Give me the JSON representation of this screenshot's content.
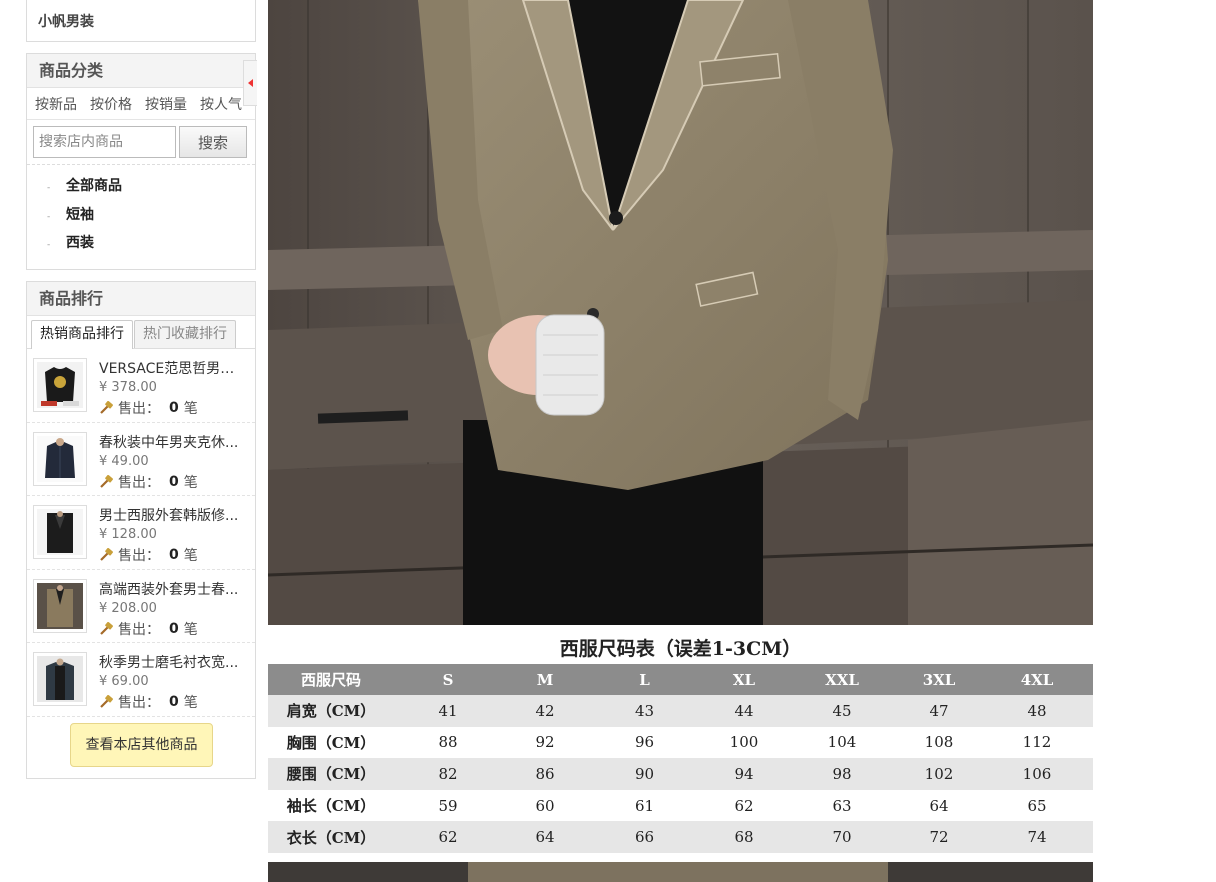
{
  "shop": {
    "name": "小帆男装"
  },
  "category": {
    "title": "商品分类",
    "sort_options": [
      "按新品",
      "按价格",
      "按销量",
      "按人气"
    ],
    "search": {
      "placeholder": "搜索店内商品",
      "button": "搜索"
    },
    "items": [
      "全部商品",
      "短袖",
      "西装"
    ],
    "bullet": "-"
  },
  "ranking": {
    "title": "商品排行",
    "tabs": [
      "热销商品排行",
      "热门收藏排行"
    ],
    "sold_label": "售出：",
    "sold_unit": "笔",
    "products": [
      {
        "name": "VERSACE范思哲男装...",
        "price": "¥ 378.00",
        "sold": "0"
      },
      {
        "name": "春秋装中年男夹克休...",
        "price": "¥ 49.00",
        "sold": "0"
      },
      {
        "name": "男士西服外套韩版修...",
        "price": "¥ 128.00",
        "sold": "0"
      },
      {
        "name": "高端西装外套男士春...",
        "price": "¥ 208.00",
        "sold": "0"
      },
      {
        "name": "秋季男士磨毛衬衣宽...",
        "price": "¥ 69.00",
        "sold": "0"
      }
    ],
    "more_button": "查看本店其他商品"
  },
  "size_chart": {
    "title": "西服尺码表（误差1-3CM）",
    "headers": [
      "西服尺码",
      "S",
      "M",
      "L",
      "XL",
      "XXL",
      "3XL",
      "4XL"
    ],
    "rows": [
      [
        "肩宽（CM）",
        "41",
        "42",
        "43",
        "44",
        "45",
        "47",
        "48"
      ],
      [
        "胸围（CM）",
        "88",
        "92",
        "96",
        "100",
        "104",
        "108",
        "112"
      ],
      [
        "腰围（CM）",
        "82",
        "86",
        "90",
        "94",
        "98",
        "102",
        "106"
      ],
      [
        "袖长（CM）",
        "59",
        "60",
        "61",
        "62",
        "63",
        "64",
        "65"
      ],
      [
        "衣长（CM）",
        "62",
        "64",
        "66",
        "68",
        "70",
        "72",
        "74"
      ]
    ]
  },
  "icons": {
    "collapse": "collapse-left-icon",
    "sold": "hammer-icon"
  },
  "colors": {
    "accent_red": "#e33",
    "more_button_bg": "#fff6b8",
    "table_header": "#8c8c8c"
  }
}
